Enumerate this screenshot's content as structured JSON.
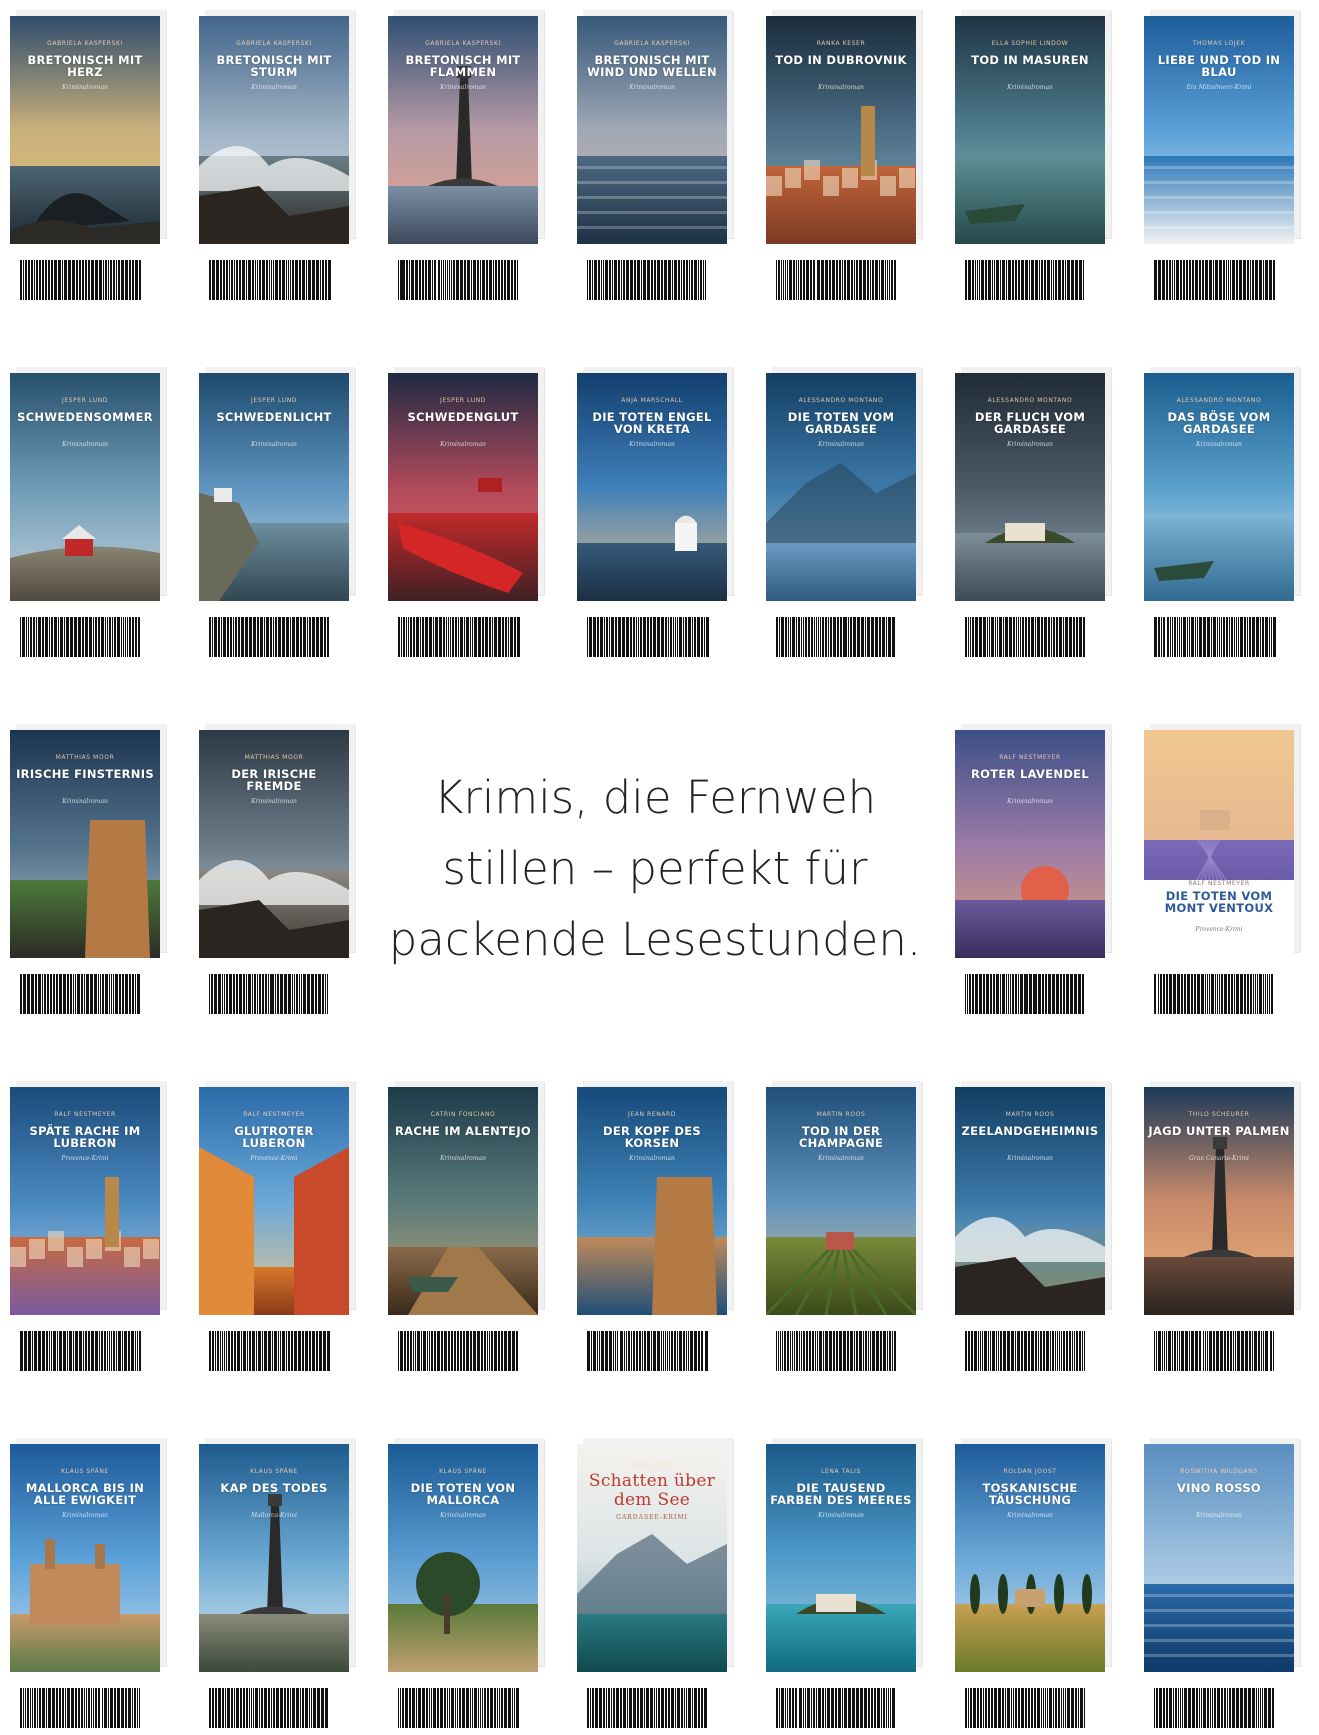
{
  "tagline": {
    "line1": "Krimis, die Fernweh",
    "line2": "stillen – perfekt für",
    "line3": "packende Lesestunden."
  },
  "books": [
    {
      "author": "Gabriela Kasperski",
      "title": "Bretonisch mit Herz",
      "sub": "Kriminalroman",
      "sky": [
        "#2f4d6e",
        "#c9b07a",
        "#e9c27a"
      ],
      "ground": [
        "#4d6472",
        "#1d2a33"
      ],
      "scene": "rock"
    },
    {
      "author": "Gabriela Kasperski",
      "title": "Bretonisch mit Sturm",
      "sub": "Kriminalroman",
      "sky": [
        "#41658a",
        "#9fb2c4",
        "#d8e0e8"
      ],
      "ground": [
        "#6a7d86",
        "#2a2722"
      ],
      "scene": "wave"
    },
    {
      "author": "Gabriela Kasperski",
      "title": "Bretonisch mit Flammen",
      "sub": "Kriminalroman",
      "sky": [
        "#2f4f73",
        "#b69aa6",
        "#e6a487"
      ],
      "ground": [
        "#7b8ea3",
        "#3d4a5c"
      ],
      "scene": "lighthouse"
    },
    {
      "author": "Gabriela Kasperski",
      "title": "Bretonisch mit Wind und Wellen",
      "sub": "Kriminalroman",
      "sky": [
        "#35587a",
        "#a0a8b5",
        "#dcb9a6"
      ],
      "ground": [
        "#4c6a82",
        "#1f3246"
      ],
      "scene": "sea"
    },
    {
      "author": "Ranka Keser",
      "title": "Tod in Dubrovnik",
      "sub": "Kriminalroman",
      "sky": [
        "#1a2c3c",
        "#4b6d85",
        "#8fb3c4"
      ],
      "ground": [
        "#c2643a",
        "#7b3a24"
      ],
      "scene": "town"
    },
    {
      "author": "Ella Sophie Lindow",
      "title": "Tod in Masuren",
      "sub": "Kriminalroman",
      "sky": [
        "#1f3545",
        "#4e7c8c",
        "#9fc1c6"
      ],
      "ground": [
        "#5d8f94",
        "#254a4d"
      ],
      "scene": "lake"
    },
    {
      "author": "Thomas Lojek",
      "title": "Liebe und Tod in Blau",
      "sub": "Ein Mittelmeer-Krimi",
      "sky": [
        "#1d5d9a",
        "#5aa0d8",
        "#cfe4f2"
      ],
      "ground": [
        "#2d78b8",
        "#f3f3f3"
      ],
      "scene": "sea"
    },
    {
      "author": "Jesper Lund",
      "title": "Schwedensommer",
      "sub": "Kriminalroman",
      "sky": [
        "#27506e",
        "#6f9ab5",
        "#c2d5df"
      ],
      "ground": [
        "#8a8472",
        "#4e4a3e"
      ],
      "scene": "house"
    },
    {
      "author": "Jesper Lund",
      "title": "Schwedenlicht",
      "sub": "Kriminalroman",
      "sky": [
        "#1d4a6e",
        "#5f93bd",
        "#c3dbe8"
      ],
      "ground": [
        "#6d8f9e",
        "#314653"
      ],
      "scene": "coast"
    },
    {
      "author": "Jesper Lund",
      "title": "Schwedenglut",
      "sub": "Kriminalroman",
      "sky": [
        "#1f2a44",
        "#b04a5a",
        "#e86a6a"
      ],
      "ground": [
        "#c22a2a",
        "#402024"
      ],
      "scene": "boat"
    },
    {
      "author": "Anja Marschall",
      "title": "Die toten Engel von Kreta",
      "sub": "Kriminalroman",
      "sky": [
        "#123f6e",
        "#3f7fba",
        "#e9c08a"
      ],
      "ground": [
        "#355a7a",
        "#1c2f44"
      ],
      "scene": "chapel"
    },
    {
      "author": "Alessandro Montano",
      "title": "Die Toten vom Gardasee",
      "sub": "Kriminalroman",
      "sky": [
        "#123e63",
        "#3d79a8",
        "#9cc2de"
      ],
      "ground": [
        "#6a9bc2",
        "#2e5a80"
      ],
      "scene": "mountain"
    },
    {
      "author": "Alessandro Montano",
      "title": "Der Fluch vom Gardasee",
      "sub": "Kriminalroman",
      "sky": [
        "#202b36",
        "#4b5a66",
        "#8fa0ab"
      ],
      "ground": [
        "#7d8f99",
        "#3c4b55"
      ],
      "scene": "island"
    },
    {
      "author": "Alessandro Montano",
      "title": "Das Böse vom Gardasee",
      "sub": "Kriminalroman",
      "sky": [
        "#1a5d8e",
        "#5aa0cc",
        "#cfe3ef"
      ],
      "ground": [
        "#7fb6d6",
        "#2f6a90"
      ],
      "scene": "lake"
    },
    {
      "author": "Matthias Moor",
      "title": "Irische Finsternis",
      "sub": "Kriminalroman",
      "sky": [
        "#1c3550",
        "#52718a",
        "#b0c0c8"
      ],
      "ground": [
        "#4d7a3a",
        "#2c2a26"
      ],
      "scene": "cliff"
    },
    {
      "author": "Matthias Moor",
      "title": "Der irische Fremde",
      "sub": "Kriminalroman",
      "sky": [
        "#2c3a46",
        "#6a7a86",
        "#c0c8cc"
      ],
      "ground": [
        "#8a8880",
        "#3a3630"
      ],
      "scene": "wave"
    },
    {
      "author": "Ralf Nestmeyer",
      "title": "Roter Lavendel",
      "sub": "Kriminalroman",
      "sky": [
        "#3c4f86",
        "#9a7aa8",
        "#e0a07a"
      ],
      "ground": [
        "#6b5a9a",
        "#3a2d5c"
      ],
      "scene": "sun"
    },
    {
      "author": "Ralf Nestmeyer",
      "title": "Die Toten vom Mont Ventoux",
      "sub": "Provence-Krimi",
      "sky": [
        "#f0c890",
        "#e6b890",
        "#b8a0c8"
      ],
      "ground": [
        "#7a6ab8",
        "#4a3c88"
      ],
      "scene": "lavender",
      "style": "white"
    },
    {
      "author": "Ralf Nestmeyer",
      "title": "Späte Rache im Luberon",
      "sub": "Provence-Krimi",
      "sky": [
        "#1a4b7a",
        "#4a88c0",
        "#a8cce6"
      ],
      "ground": [
        "#c86a40",
        "#7a5aa0"
      ],
      "scene": "town"
    },
    {
      "author": "Ralf Nestmeyer",
      "title": "Glutroter Luberon",
      "sub": "Provence-Krimi",
      "sky": [
        "#2a6aa8",
        "#6aa8d8",
        "#e8c890"
      ],
      "ground": [
        "#d8782a",
        "#8a3a1a"
      ],
      "scene": "alley"
    },
    {
      "author": "Catrin Fonciano",
      "title": "Rache im Alentejo",
      "sub": "Kriminalroman",
      "sky": [
        "#1d3a4a",
        "#5a7a7a",
        "#c2a878"
      ],
      "ground": [
        "#8a6a4a",
        "#3a2a1a"
      ],
      "scene": "pier"
    },
    {
      "author": "Jean Renard",
      "title": "Der Kopf des Korsen",
      "sub": "Kriminalroman",
      "sky": [
        "#154a7a",
        "#3f82b6",
        "#9cc6e2"
      ],
      "ground": [
        "#c08a5a",
        "#1f4f78"
      ],
      "scene": "cliff"
    },
    {
      "author": "Martin Roos",
      "title": "Tod in der Champagne",
      "sub": "Kriminalroman",
      "sky": [
        "#1f4f7a",
        "#5f92bc",
        "#d8c89a"
      ],
      "ground": [
        "#7a8a3a",
        "#3a4a1a"
      ],
      "scene": "field"
    },
    {
      "author": "Martin Roos",
      "title": "Zeelandgeheimnis",
      "sub": "Kriminalroman",
      "sky": [
        "#123e63",
        "#3a78a8",
        "#a6c8de"
      ],
      "ground": [
        "#5a8aaa",
        "#8a8a5a"
      ],
      "scene": "wave"
    },
    {
      "author": "Thilo Scheurer",
      "title": "Jagd unter Palmen",
      "sub": "Gran Canaria-Krimi",
      "sky": [
        "#1d3a5a",
        "#c88a6a",
        "#f0b27a"
      ],
      "ground": [
        "#6a4a3a",
        "#2a2420"
      ],
      "scene": "lighthouse"
    },
    {
      "author": "Klaus Späne",
      "title": "Mallorca bis in alle Ewigkeit",
      "sub": "Kriminalroman",
      "sky": [
        "#1d5a9a",
        "#5aa0d8",
        "#bcd8ee"
      ],
      "ground": [
        "#c89a6a",
        "#5a7a4a"
      ],
      "scene": "cathedral"
    },
    {
      "author": "Klaus Späne",
      "title": "Kap des Todes",
      "sub": "Mallorca-Krimi",
      "sky": [
        "#1d5a8e",
        "#6aa8d2",
        "#d8e8f0"
      ],
      "ground": [
        "#8a8a7a",
        "#3a4a3a"
      ],
      "scene": "lighthouse"
    },
    {
      "author": "Klaus Späne",
      "title": "Die Toten von Mallorca",
      "sub": "Kriminalroman",
      "sky": [
        "#1a5a96",
        "#5a9cd0",
        "#b8d6ec"
      ],
      "ground": [
        "#5a7a3a",
        "#c0a070"
      ],
      "scene": "tree"
    },
    {
      "author": "Doris Stenig",
      "title": "Schatten über dem See",
      "sub": "GARDASEE-KRIMI",
      "sky": [
        "#f4f2ee",
        "#dce4e6",
        "#7aa8b0"
      ],
      "ground": [
        "#2a7a80",
        "#0f4a50"
      ],
      "scene": "mountain",
      "style": "schatten"
    },
    {
      "author": "Lena Talis",
      "title": "Die tausend Farben des Meeres",
      "sub": "Kriminalroman",
      "sky": [
        "#1a5a8a",
        "#4e9ac8",
        "#a0d0e4"
      ],
      "ground": [
        "#3aa8b8",
        "#0f6a80"
      ],
      "scene": "island"
    },
    {
      "author": "Roldan Joost",
      "title": "Toskanische Täuschung",
      "sub": "Kriminalroman",
      "sky": [
        "#1d5a9a",
        "#6aa8d8",
        "#cfe2f0"
      ],
      "ground": [
        "#c8a050",
        "#6a7a2a"
      ],
      "scene": "cypress"
    },
    {
      "author": "Roswitha Wildgans",
      "title": "Vino Rosso",
      "sub": "Kriminalroman",
      "sky": [
        "#5a8ec0",
        "#9cc0de",
        "#d8e6f0"
      ],
      "ground": [
        "#2a6aa8",
        "#0f3a6a"
      ],
      "scene": "sea"
    }
  ]
}
